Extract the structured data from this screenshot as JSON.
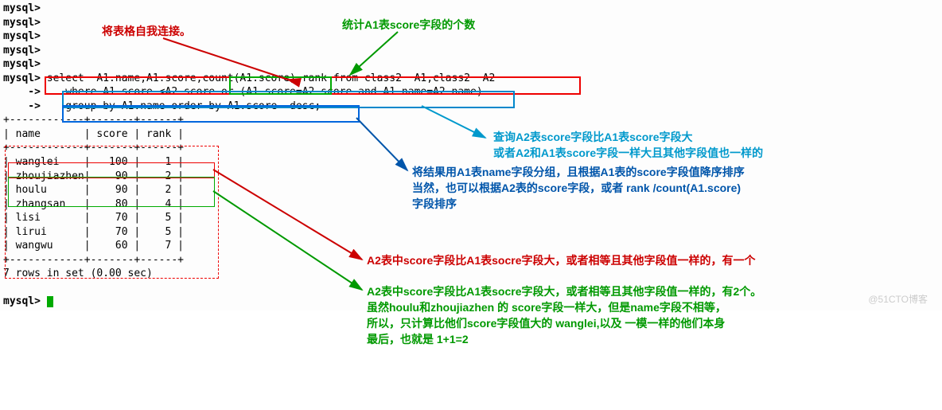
{
  "prompts": {
    "mysql": "mysql>",
    "cont": "    ->",
    "blank_prompts_count": 5
  },
  "sql": {
    "line1": " select  A1.name,A1.score,count(A1.score) rank from class2  A1,class2  A2",
    "line2": "    where A1.score <A2.score or (A1.score=A2.score and A1.name=A2.name)",
    "line3": "    group by A1.name order by A1.score  desc;"
  },
  "table": {
    "sep": "+------------+-------+------+",
    "header": "| name       | score | rank |",
    "rows": [
      "| wanglei    |   100 |    1 |",
      "| zhoujiazhen|    90 |    2 |",
      "| houlu      |    90 |    2 |",
      "| zhangsan   |    80 |    4 |",
      "| lisi       |    70 |    5 |",
      "| lirui      |    70 |    5 |",
      "| wangwu     |    60 |    7 |"
    ]
  },
  "footer": {
    "rows_msg": "7 rows in set (0.00 sec)",
    "final_prompt": "mysql> "
  },
  "annotations": {
    "self_join": "将表格自我连接。",
    "count_label": "统计A1表score字段的个数",
    "where_l1": "查询A2表score字段比A1表score字段大",
    "where_l2": "或者A2和A1表score字段一样大且其他字段值也一样的",
    "group_l1": "将结果用A1表name字段分组，且根据A1表的score字段值降序排序",
    "group_l2": "当然，也可以根据A2表的score字段，或者 rank /count(A1.score)",
    "group_l3": "字段排序",
    "rank1": "A2表中score字段比A1表socre字段大，或者相等且其他字段值一样的，有一个",
    "rank2_l1": "A2表中score字段比A1表socre字段大，或者相等且其他字段值一样的，有2个。",
    "rank2_l2": "虽然houlu和zhoujiazhen 的 score字段一样大，但是name字段不相等，",
    "rank2_l3": "所以，只计算比他们score字段值大的 wanglei,以及 一模一样的他们本身",
    "rank2_l4": "最后，也就是 1+1=2"
  },
  "watermark": "@51CTO博客"
}
